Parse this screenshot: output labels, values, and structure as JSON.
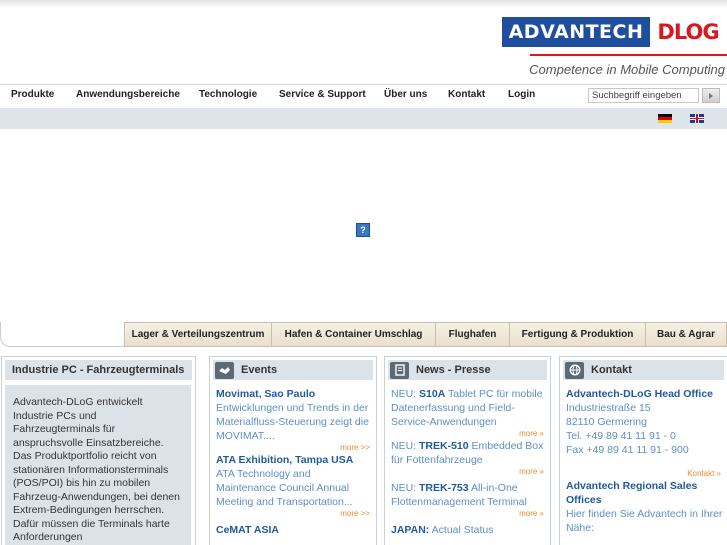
{
  "brand": {
    "logo_left": "ADVANTECH",
    "logo_right": "DLOG",
    "tagline": "Competence in Mobile Computing"
  },
  "nav": {
    "items": [
      "Produkte",
      "Anwendungsbereiche",
      "Technologie",
      "Service & Support",
      "Über uns",
      "Kontakt",
      "Login"
    ],
    "search_placeholder": "Suchbegriff eingeben"
  },
  "plugin_icon": "?",
  "categories": [
    "Lager & Verteilungszentrum",
    "Hafen & Container Umschlag",
    "Flughafen",
    "Fertigung & Produktion",
    "Bau & Agrar"
  ],
  "intro": {
    "title": "Industrie PC - Fahrzeugterminals",
    "text": "Advantech-DLoG entwickelt Industrie PCs und Fahrzeugterminals für anspruchsvolle Einsatzbereiche. Das Produktportfolio reicht von stationären Informationsterminals (POS/POI) bis hin zu mobilen Fahrzeug-Anwendungen, bei denen Extrem-Bedingungen herrschen. Dafür müssen die Terminals harte Anforderungen"
  },
  "events": {
    "title": "Events",
    "items": [
      {
        "title": "Movimat, Sao Paulo",
        "text": "Entwicklungen und Trends in der Materialfluss-Steuerung zeigt die MOVIMAT....",
        "more": "more >>"
      },
      {
        "title": "ATA Exhibition, Tampa USA",
        "text": "ATA Technology and Maintenance Council Annual Meeting and Transportation...",
        "more": "more >>"
      },
      {
        "title": "CeMAT ASIA",
        "text": "",
        "more": ""
      }
    ]
  },
  "news": {
    "title": "News - Presse",
    "items": [
      {
        "prefix": "NEU: ",
        "product": "S10A",
        "text": " Tablet PC für mobile Datenerfassung und Field-Service-Anwendungen",
        "more": "more »"
      },
      {
        "prefix": "NEU: ",
        "product": "TREK-510",
        "text": " Embedded Box für Fottenfahrzeuge",
        "more": "more »"
      },
      {
        "prefix": "NEU: ",
        "product": "TREK-753",
        "text": " All-in-One Flottenmanagement Terminal",
        "more": "more »"
      },
      {
        "prefix": "",
        "product": "JAPAN:",
        "text": " Actual Status",
        "more": ""
      }
    ]
  },
  "contact": {
    "title": "Kontakt",
    "head_office": {
      "title": "Advantech-DLoG Head Office",
      "street": "Industriestraße 15",
      "city": "82110 Germering",
      "tel": "Tel. +49 89 41 11 91 - 0",
      "fax": "Fax +49 89 41 11 91 - 900"
    },
    "more": "Kontakt »",
    "regional": {
      "title": "Advantech Regional Sales Offices",
      "text": "Hier finden Sie Advantech in Ihrer Nähe:"
    }
  }
}
